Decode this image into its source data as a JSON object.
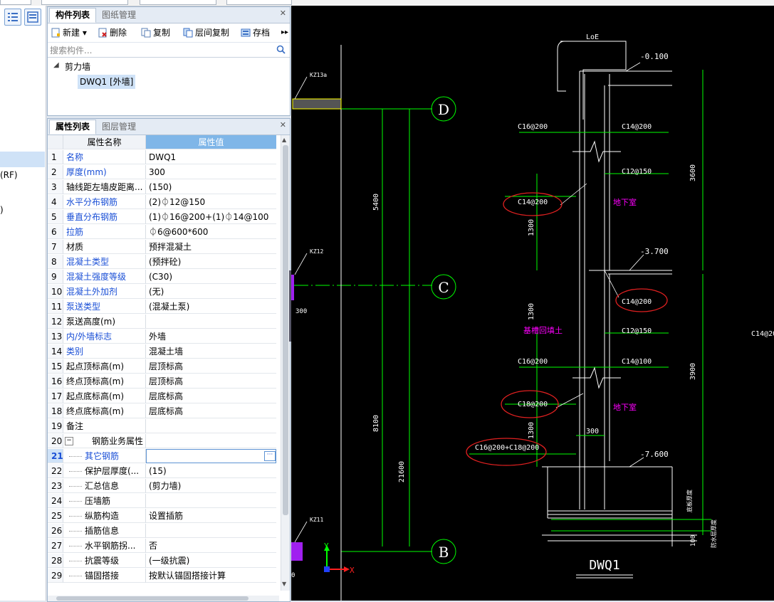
{
  "left_strip": {
    "labels": [
      "(RF)",
      ")"
    ]
  },
  "component_panel": {
    "tabs": [
      "构件列表",
      "图纸管理"
    ],
    "toolbar": {
      "new": "新建",
      "delete": "删除",
      "copy": "复制",
      "floor_copy": "层间复制",
      "save": "存档",
      "more": "▸▸"
    },
    "search_placeholder": "搜索构件...",
    "tree": {
      "group": "剪力墙",
      "item": "DWQ1 [外墙]"
    }
  },
  "property_panel": {
    "tabs": [
      "属性列表",
      "图层管理"
    ],
    "header": {
      "name": "属性名称",
      "value": "属性值"
    },
    "rows": [
      {
        "no": "1",
        "name": "名称",
        "value": "DWQ1",
        "blue": true
      },
      {
        "no": "2",
        "name": "厚度(mm)",
        "value": "300",
        "blue": true
      },
      {
        "no": "3",
        "name": "轴线距左墙皮距离...",
        "value": "(150)",
        "blue": false
      },
      {
        "no": "4",
        "name": "水平分布钢筋",
        "value": "(2)⏀12@150",
        "blue": true
      },
      {
        "no": "5",
        "name": "垂直分布钢筋",
        "value": "(1)⏀16@200+(1)⏀14@100",
        "blue": true
      },
      {
        "no": "6",
        "name": "拉筋",
        "value": "⏀6@600*600",
        "blue": true
      },
      {
        "no": "7",
        "name": "材质",
        "value": "预拌混凝土",
        "blue": false
      },
      {
        "no": "8",
        "name": "混凝土类型",
        "value": "(预拌砼)",
        "blue": true
      },
      {
        "no": "9",
        "name": "混凝土强度等级",
        "value": "(C30)",
        "blue": true
      },
      {
        "no": "10",
        "name": "混凝土外加剂",
        "value": "(无)",
        "blue": true
      },
      {
        "no": "11",
        "name": "泵送类型",
        "value": "(混凝土泵)",
        "blue": true
      },
      {
        "no": "12",
        "name": "泵送高度(m)",
        "value": "",
        "blue": false
      },
      {
        "no": "13",
        "name": "内/外墙标志",
        "value": "外墙",
        "blue": true
      },
      {
        "no": "14",
        "name": "类别",
        "value": "混凝土墙",
        "blue": true
      },
      {
        "no": "15",
        "name": "起点顶标高(m)",
        "value": "层顶标高",
        "blue": false
      },
      {
        "no": "16",
        "name": "终点顶标高(m)",
        "value": "层顶标高",
        "blue": false
      },
      {
        "no": "17",
        "name": "起点底标高(m)",
        "value": "层底标高",
        "blue": false
      },
      {
        "no": "18",
        "name": "终点底标高(m)",
        "value": "层底标高",
        "blue": false
      },
      {
        "no": "19",
        "name": "备注",
        "value": "",
        "blue": false
      },
      {
        "no": "20",
        "name": "钢筋业务属性",
        "value": "",
        "blue": false
      },
      {
        "no": "21",
        "name": "其它钢筋",
        "value": "",
        "blue": true
      },
      {
        "no": "22",
        "name": "保护层厚度(...",
        "value": "(15)",
        "blue": false
      },
      {
        "no": "23",
        "name": "汇总信息",
        "value": "(剪力墙)",
        "blue": false
      },
      {
        "no": "24",
        "name": "压墙筋",
        "value": "",
        "blue": false
      },
      {
        "no": "25",
        "name": "纵筋构造",
        "value": "设置插筋",
        "blue": false
      },
      {
        "no": "26",
        "name": "插筋信息",
        "value": "",
        "blue": false
      },
      {
        "no": "27",
        "name": "水平钢筋拐...",
        "value": "否",
        "blue": false
      },
      {
        "no": "28",
        "name": "抗震等级",
        "value": "(一级抗震)",
        "blue": false
      },
      {
        "no": "29",
        "name": "锚固搭接",
        "value": "按默认锚固搭接计算",
        "blue": false
      }
    ]
  },
  "cad": {
    "axis_labels": [
      "D",
      "C",
      "B"
    ],
    "column_tags": [
      "KZ13a",
      "KZ12",
      "KZ11"
    ],
    "left_text": [
      "300",
      "0"
    ],
    "dims_vertical": [
      "5400",
      "8100",
      "21600",
      "3600",
      "1300",
      "1300",
      "3900",
      "1300",
      "100"
    ],
    "levels": [
      "-0.100",
      "-3.700",
      "-7.600"
    ],
    "rebar_labels": [
      "LoE",
      "C16@200",
      "C14@200",
      "C12@150",
      "C14@200",
      "C14@200",
      "C12@150",
      "C16@200",
      "C14@100",
      "C18@200",
      "C16@200+C18@200",
      "C14@20"
    ],
    "room_labels": [
      "地下室",
      "基槽回填土",
      "地下室"
    ],
    "dim_300": "300",
    "vertical_notes": [
      "底板厚度",
      "防水层厚度"
    ],
    "title": "DWQ1",
    "ucs": {
      "x": "X",
      "y": "Y"
    }
  }
}
